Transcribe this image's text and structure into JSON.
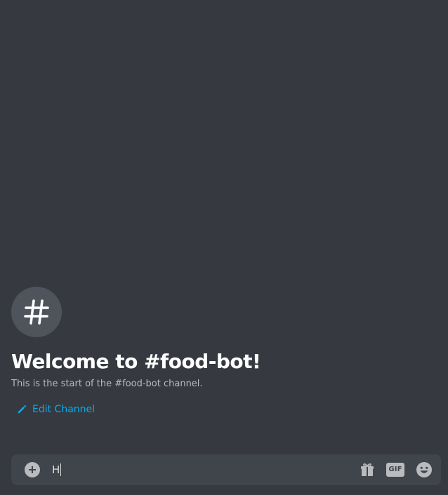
{
  "welcome": {
    "title": "Welcome to #food-bot!",
    "subtitle": "This is the start of the #food-bot channel.",
    "edit_label": "Edit Channel",
    "avatar_icon": "hashtag-icon"
  },
  "composer": {
    "value": "H",
    "icons": [
      "add-icon",
      "gift-icon",
      "gif-icon",
      "emoji-icon"
    ],
    "gif_label": "GIF"
  },
  "colors": {
    "background": "#36393f",
    "composer": "#40444b",
    "link": "#00aff4",
    "title": "#ffffff"
  }
}
